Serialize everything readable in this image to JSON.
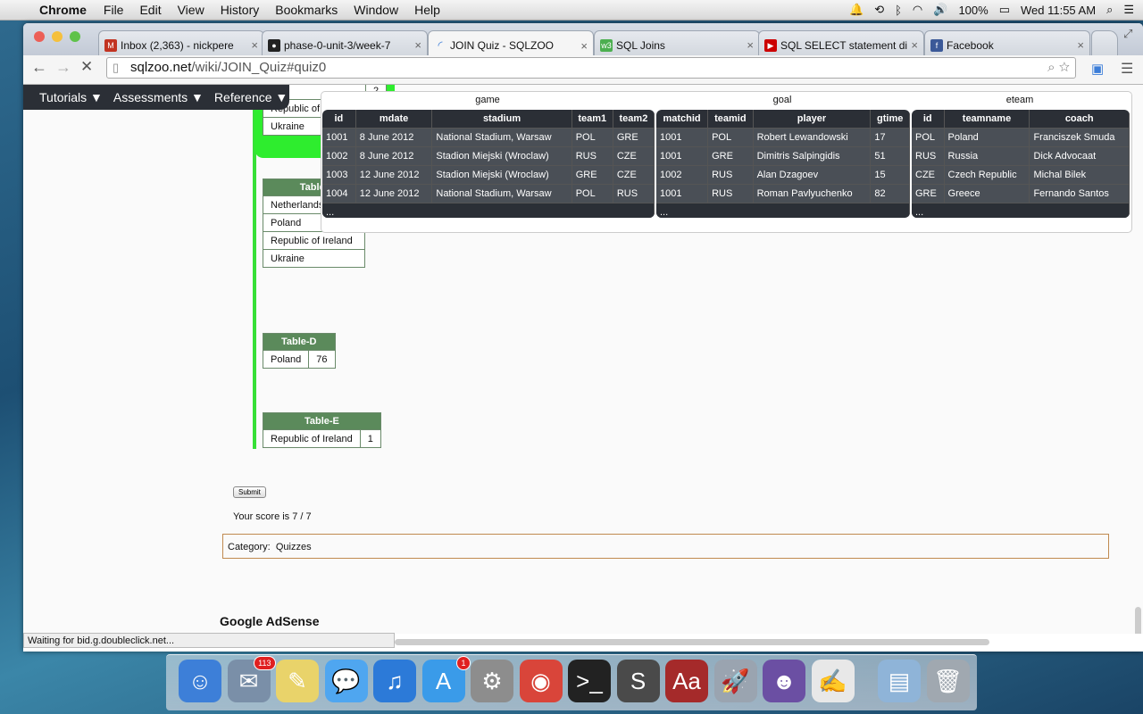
{
  "menubar": {
    "app": "Chrome",
    "items": [
      "File",
      "Edit",
      "View",
      "History",
      "Bookmarks",
      "Window",
      "Help"
    ],
    "battery": "100%",
    "clock": "Wed 11:55 AM"
  },
  "tabs": [
    {
      "title": "Inbox (2,363) - nickpere",
      "icon": "gmail-icon",
      "color": "#c23321"
    },
    {
      "title": "phase-0-unit-3/week-7",
      "icon": "github-icon",
      "color": "#222222"
    },
    {
      "title": "JOIN Quiz - SQLZOO",
      "icon": "loading-icon",
      "color": "#3b7dd8"
    },
    {
      "title": "SQL Joins",
      "icon": "w3schools-icon",
      "color": "#4caf50"
    },
    {
      "title": "SQL SELECT statement di",
      "icon": "youtube-icon",
      "color": "#cc0000"
    },
    {
      "title": "Facebook",
      "icon": "facebook-icon",
      "color": "#3b5998"
    }
  ],
  "address": {
    "domain": "sqlzoo.net",
    "path": "/wiki/JOIN_Quiz#quiz0"
  },
  "sitenav": {
    "tutorials": "Tutorials ▼",
    "assessments": "Assessments ▼",
    "reference": "Reference ▼"
  },
  "partial_table": {
    "rows": [
      [
        "land",
        "2"
      ],
      [
        "Republic of",
        ""
      ],
      [
        "Ukraine",
        ""
      ]
    ]
  },
  "table_c": {
    "header": "Table-",
    "rows": [
      "Netherlands",
      "Poland",
      "Republic of Ireland",
      "Ukraine"
    ]
  },
  "table_d": {
    "header": "Table-D",
    "rows": [
      [
        "Poland",
        "76"
      ]
    ]
  },
  "table_e": {
    "header": "Table-E",
    "rows": [
      [
        "Republic of Ireland",
        "1"
      ]
    ]
  },
  "schema": {
    "game": {
      "title": "game",
      "columns": [
        "id",
        "mdate",
        "stadium",
        "team1",
        "team2"
      ],
      "rows": [
        [
          "1001",
          "8 June 2012",
          "National Stadium, Warsaw",
          "POL",
          "GRE"
        ],
        [
          "1002",
          "8 June 2012",
          "Stadion Miejski (Wroclaw)",
          "RUS",
          "CZE"
        ],
        [
          "1003",
          "12 June 2012",
          "Stadion Miejski (Wroclaw)",
          "GRE",
          "CZE"
        ],
        [
          "1004",
          "12 June 2012",
          "National Stadium, Warsaw",
          "POL",
          "RUS"
        ]
      ],
      "more": "..."
    },
    "goal": {
      "title": "goal",
      "columns": [
        "matchid",
        "teamid",
        "player",
        "gtime"
      ],
      "rows": [
        [
          "1001",
          "POL",
          "Robert Lewandowski",
          "17"
        ],
        [
          "1001",
          "GRE",
          "Dimitris Salpingidis",
          "51"
        ],
        [
          "1002",
          "RUS",
          "Alan Dzagoev",
          "15"
        ],
        [
          "1001",
          "RUS",
          "Roman Pavlyuchenko",
          "82"
        ]
      ],
      "more": "..."
    },
    "eteam": {
      "title": "eteam",
      "columns": [
        "id",
        "teamname",
        "coach"
      ],
      "rows": [
        [
          "POL",
          "Poland",
          "Franciszek Smuda"
        ],
        [
          "RUS",
          "Russia",
          "Dick Advocaat"
        ],
        [
          "CZE",
          "Czech Republic",
          "Michal Bilek"
        ],
        [
          "GRE",
          "Greece",
          "Fernando Santos"
        ]
      ],
      "more": "..."
    }
  },
  "submit_label": "Submit",
  "score": "Your score is 7 / 7",
  "category": {
    "label": "Category:",
    "value": "Quizzes"
  },
  "adsense": "Google AdSense",
  "status": "Waiting for bid.g.doubleclick.net...",
  "dock": [
    {
      "name": "finder-icon",
      "color": "#3d7fd8",
      "glyph": "☺"
    },
    {
      "name": "mail-icon",
      "color": "#7a8fa8",
      "glyph": "✉",
      "badge": "113"
    },
    {
      "name": "stickies-icon",
      "color": "#e9d36a",
      "glyph": "✎"
    },
    {
      "name": "messages-icon",
      "color": "#4fa6f0",
      "glyph": "💬"
    },
    {
      "name": "itunes-icon",
      "color": "#2c7ad8",
      "glyph": "♫"
    },
    {
      "name": "app-store-icon",
      "color": "#3a9be9",
      "glyph": "A",
      "badge": "1"
    },
    {
      "name": "system-preferences-icon",
      "color": "#8d8d8d",
      "glyph": "⚙"
    },
    {
      "name": "chrome-icon",
      "color": "#d9453a",
      "glyph": "◉"
    },
    {
      "name": "terminal-icon",
      "color": "#222222",
      "glyph": ">_"
    },
    {
      "name": "sublime-text-icon",
      "color": "#4a4a4a",
      "glyph": "S"
    },
    {
      "name": "dictionary-icon",
      "color": "#a52a2a",
      "glyph": "Aa"
    },
    {
      "name": "rocket-icon",
      "color": "#9aa4b0",
      "glyph": "🚀"
    },
    {
      "name": "github-icon",
      "color": "#6b4fa3",
      "glyph": "☻"
    },
    {
      "name": "textedit-icon",
      "color": "#e8e8e8",
      "glyph": "✍"
    },
    {
      "name": "downloads-folder-icon",
      "color": "#8fb4d8",
      "glyph": "▤"
    },
    {
      "name": "trash-icon",
      "color": "#a0a8b0",
      "glyph": "🗑"
    }
  ]
}
